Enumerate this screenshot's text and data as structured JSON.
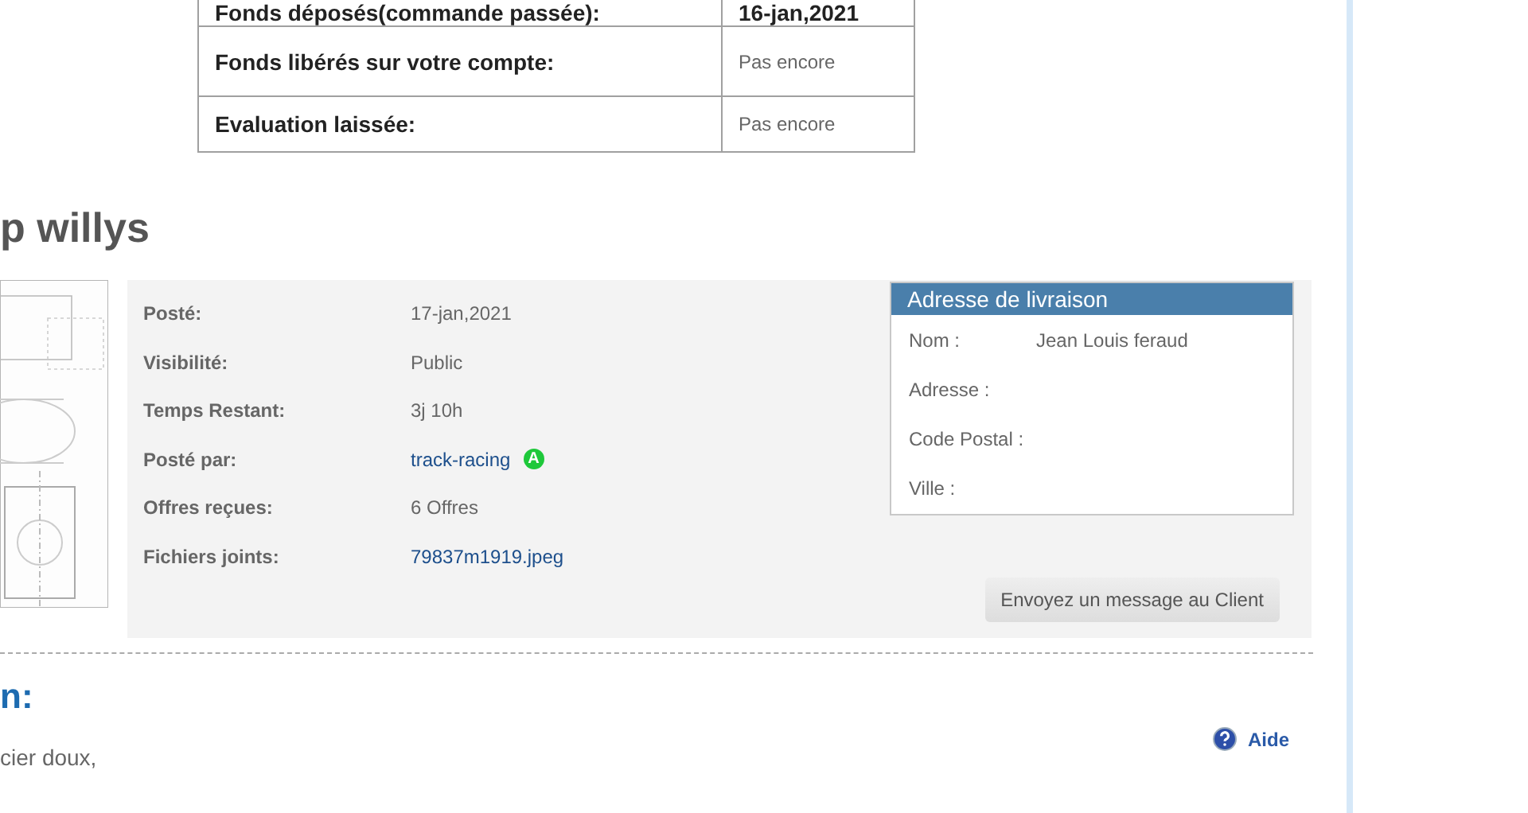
{
  "summary_table": {
    "rows": [
      {
        "label": "Fonds déposés(commande passée):",
        "value": "16-jan,2021"
      },
      {
        "label": "Fonds libérés sur votre compte:",
        "value": "Pas encore"
      },
      {
        "label": "Evaluation laissée:",
        "value": "Pas encore"
      }
    ]
  },
  "project": {
    "title": "p willys",
    "details": [
      {
        "label": "Posté:",
        "value": "17-jan,2021",
        "kind": "text"
      },
      {
        "label": "Visibilité:",
        "value": "Public",
        "kind": "text"
      },
      {
        "label": "Temps Restant:",
        "value": "3j 10h",
        "kind": "text"
      },
      {
        "label": "Posté par:",
        "value": "track-racing",
        "kind": "user",
        "badge": "A"
      },
      {
        "label": "Offres reçues:",
        "value": "6 Offres",
        "kind": "text"
      },
      {
        "label": "Fichiers joints:",
        "value": "79837m1919.jpeg",
        "kind": "link"
      }
    ],
    "shipping": {
      "title": "Adresse de livraison",
      "fields": [
        {
          "label": "Nom :",
          "value": "Jean Louis feraud"
        },
        {
          "label": "Adresse :"
        },
        {
          "label": "Code Postal :"
        },
        {
          "label": "Ville :"
        }
      ]
    },
    "message_button": "Envoyez un message au Client"
  },
  "section": {
    "title": "n:",
    "help": "Aide",
    "text": "cier doux,"
  }
}
